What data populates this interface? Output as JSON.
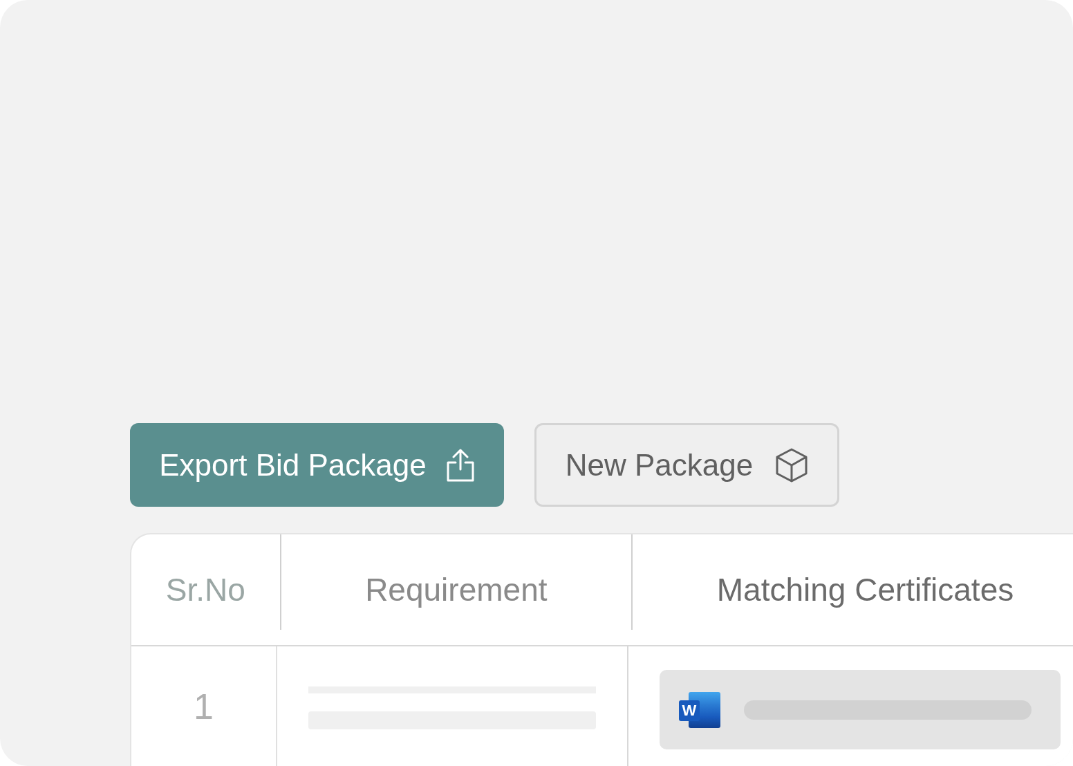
{
  "actions": [
    {
      "label": "Export Bid Package",
      "kind": "primary"
    },
    {
      "label": "New Package",
      "kind": "secondary"
    }
  ],
  "table": {
    "columns": [
      "Sr.No",
      "Requirement",
      "Matching Certificates"
    ],
    "rows": [
      {
        "sr_no": "1",
        "certificate": {
          "icon_letter": "W"
        }
      }
    ]
  }
}
